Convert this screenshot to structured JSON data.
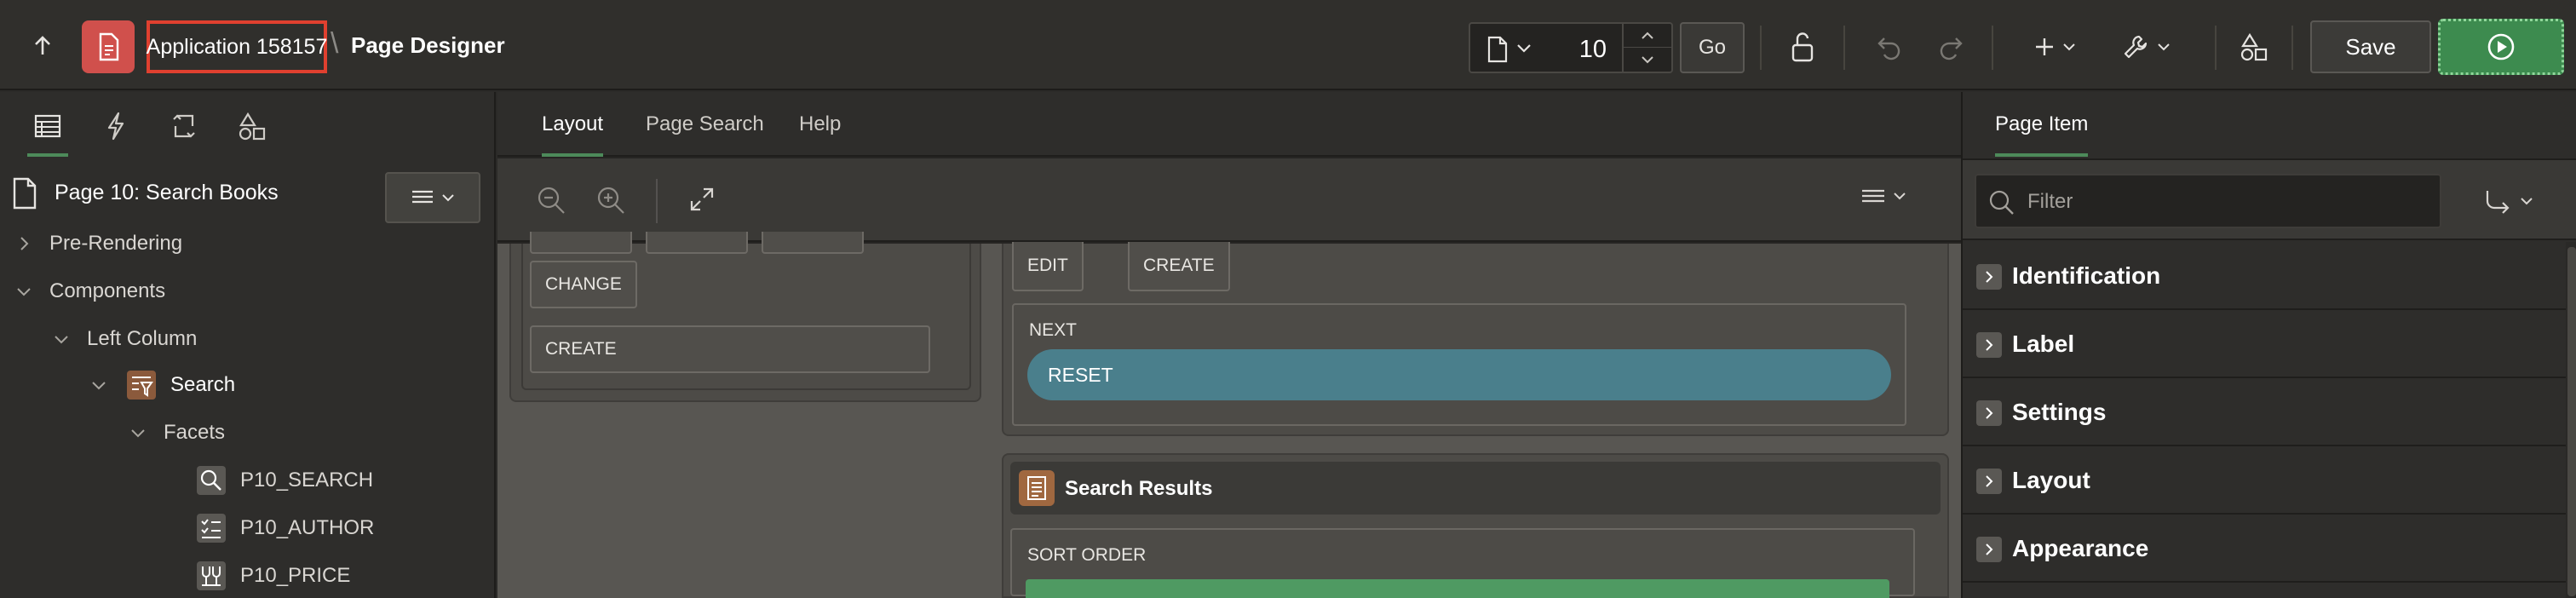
{
  "header": {
    "app_link": "Application 158157",
    "separator": "\\",
    "page_designer": "Page Designer",
    "page_number": "10",
    "go_label": "Go",
    "save_label": "Save"
  },
  "left_pane": {
    "page_title": "Page 10: Search Books",
    "tree": [
      {
        "label": "Pre-Rendering"
      },
      {
        "label": "Components"
      },
      {
        "label": "Left Column"
      },
      {
        "label": "Search"
      },
      {
        "label": "Facets"
      },
      {
        "label": "P10_SEARCH"
      },
      {
        "label": "P10_AUTHOR"
      },
      {
        "label": "P10_PRICE"
      }
    ]
  },
  "center_pane": {
    "tabs": [
      "Layout",
      "Page Search",
      "Help"
    ],
    "left_region_buttons": [
      "CHANGE",
      "CREATE"
    ],
    "right_region_buttons": [
      "EDIT",
      "CREATE"
    ],
    "next_label": "NEXT",
    "reset_label": "RESET",
    "results_title": "Search Results",
    "sort_label": "SORT ORDER"
  },
  "right_pane": {
    "tab": "Page Item",
    "filter_placeholder": "Filter",
    "sections": [
      "Identification",
      "Label",
      "Settings",
      "Layout",
      "Appearance"
    ]
  },
  "colors": {
    "accent_green": "#4d8a5a",
    "run_green": "#3d8b4f",
    "app_icon_red": "#d0504c",
    "highlight_red": "#e0402f",
    "reset_teal": "#4a7f8c"
  },
  "icons": {
    "up": "arrow-up-icon",
    "app": "app-icon",
    "page": "document-icon",
    "lock": "unlock-icon",
    "undo": "undo-icon",
    "redo": "redo-icon",
    "create": "plus-icon",
    "utilities": "wrench-icon",
    "shared": "shapes-icon",
    "run": "play-icon"
  }
}
